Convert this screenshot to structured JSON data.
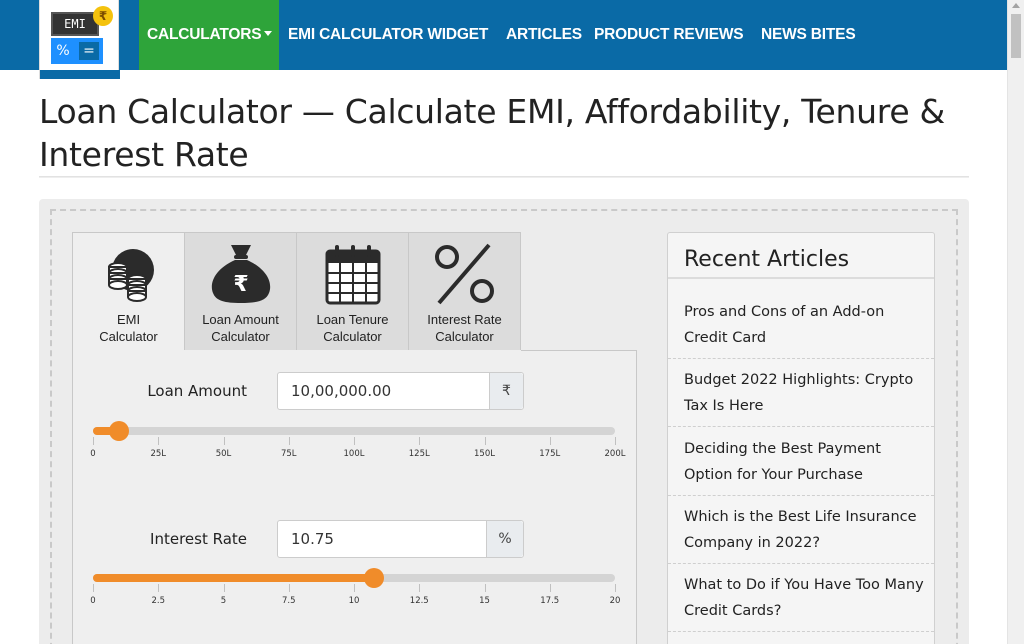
{
  "nav": {
    "logo": {
      "screen_text": "EMI",
      "badge": "₹",
      "key_left": "%",
      "key_right": "="
    },
    "items": [
      {
        "label": "CALCULATORS"
      },
      {
        "label": "EMI CALCULATOR WIDGET"
      },
      {
        "label": "ARTICLES"
      },
      {
        "label": "PRODUCT REVIEWS"
      },
      {
        "label": "NEWS BITES"
      }
    ],
    "colors": {
      "bar": "#0a6aa6",
      "active": "#2ea43a"
    }
  },
  "page": {
    "title": "Loan Calculator — Calculate EMI, Affordability, Tenure & Interest Rate"
  },
  "tabs": [
    {
      "line1": "EMI",
      "line2": "Calculator",
      "icon": "coins-icon",
      "active": true
    },
    {
      "line1": "Loan Amount",
      "line2": "Calculator",
      "icon": "money-bag-icon",
      "active": false
    },
    {
      "line1": "Loan Tenure",
      "line2": "Calculator",
      "icon": "calendar-icon",
      "active": false
    },
    {
      "line1": "Interest Rate",
      "line2": "Calculator",
      "icon": "percent-icon",
      "active": false
    }
  ],
  "loan_amount": {
    "label": "Loan Amount",
    "value": "10,00,000.00",
    "unit": "₹",
    "slider": {
      "min": 0,
      "max": 200,
      "value": 10,
      "ticks": [
        "0",
        "25L",
        "50L",
        "75L",
        "100L",
        "125L",
        "150L",
        "175L",
        "200L"
      ]
    }
  },
  "interest_rate": {
    "label": "Interest Rate",
    "value": "10.75",
    "unit": "%",
    "slider": {
      "min": 0,
      "max": 20,
      "value": 10.75,
      "ticks": [
        "0",
        "2.5",
        "5",
        "7.5",
        "10",
        "12.5",
        "15",
        "17.5",
        "20"
      ]
    }
  },
  "sidebar": {
    "title": "Recent Articles",
    "articles": [
      {
        "title": "Pros and Cons of an Add-on Credit Card"
      },
      {
        "title": "Budget 2022 Highlights: Crypto Tax Is Here"
      },
      {
        "title": "Deciding the Best Payment Option for Your Purchase"
      },
      {
        "title": "Which is the Best Life Insurance Company in 2022?"
      },
      {
        "title": "What to Do if You Have Too Many Credit Cards?"
      }
    ]
  },
  "accent_color": "#f08c2a"
}
